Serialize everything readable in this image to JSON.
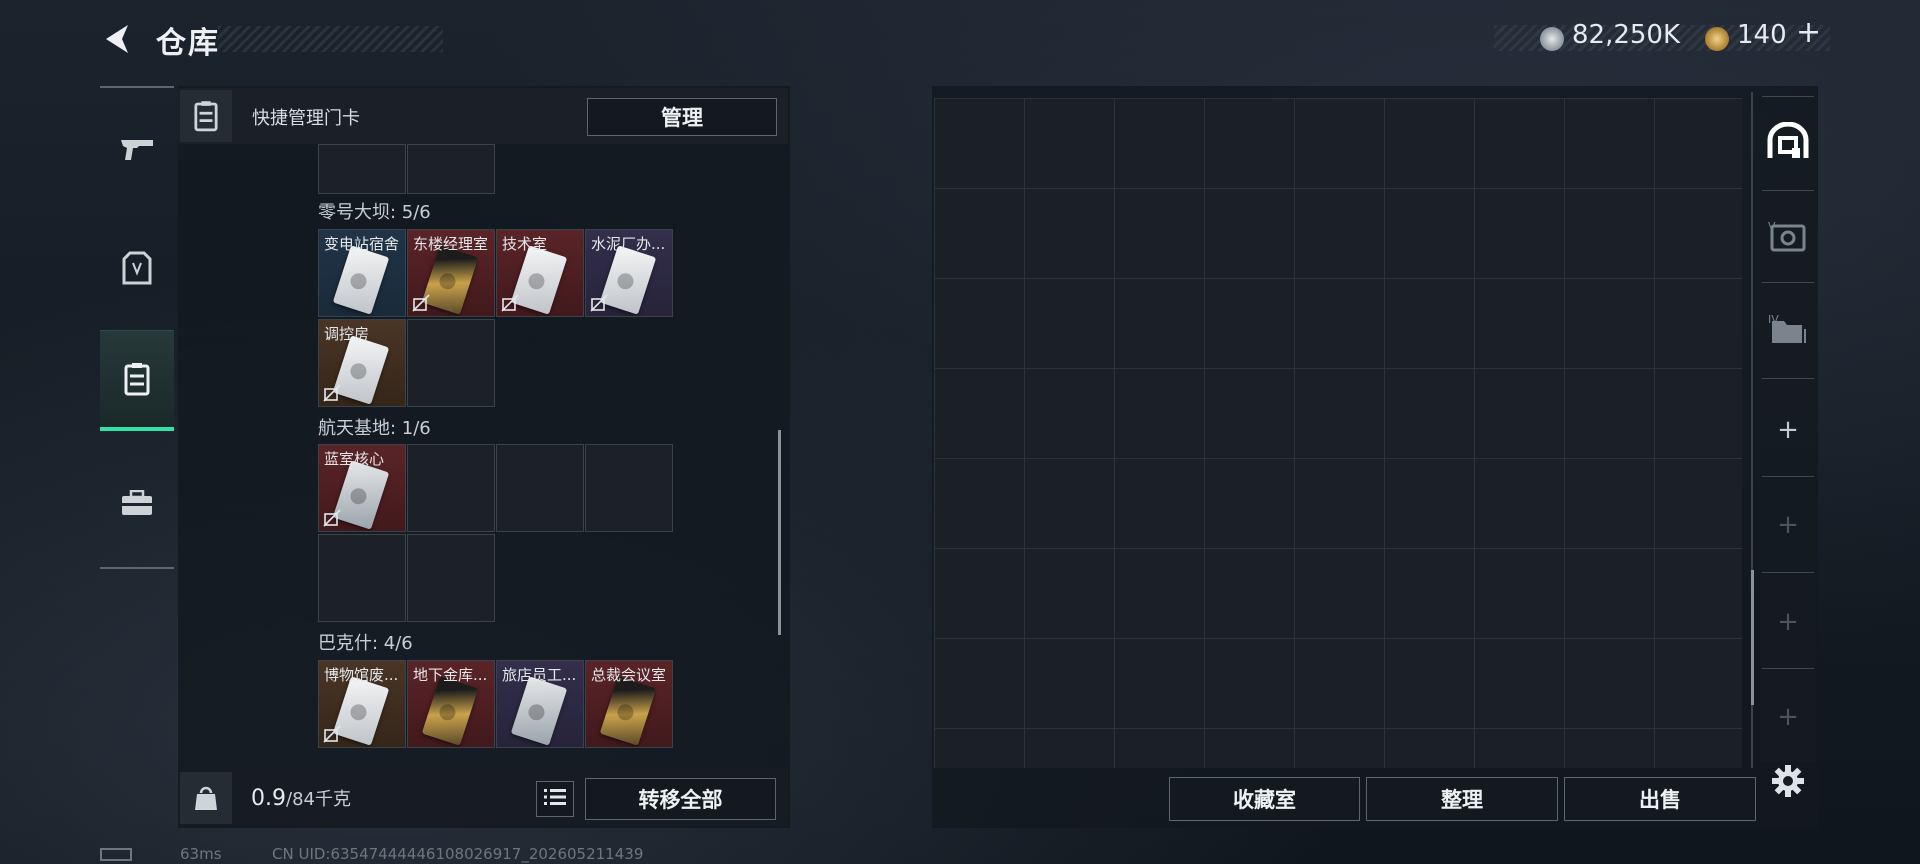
{
  "header": {
    "title": "仓库"
  },
  "currency": {
    "silver": "82,250K",
    "gold": "140",
    "plus": "+"
  },
  "quick_manage": {
    "label": "快捷管理门卡",
    "button": "管理"
  },
  "sections": [
    {
      "label": "零号大坝: 5/6",
      "cards": [
        "变电站宿舍",
        "东楼经理室",
        "技术室",
        "水泥厂办...",
        "调控房"
      ]
    },
    {
      "label": "航天基地: 1/6",
      "cards": [
        "蓝室核心"
      ]
    },
    {
      "label": "巴克什: 4/6",
      "cards": [
        "博物馆废...",
        "地下金库...",
        "旅店员工...",
        "总裁会议室"
      ]
    }
  ],
  "footer": {
    "weight_value": "0.9",
    "weight_capacity": "/84千克",
    "transfer_all": "转移全部",
    "collection": "收藏室",
    "organize": "整理",
    "sell": "出售"
  },
  "status_bar": {
    "ping": "63ms",
    "uid": "CN UID:6354744444610802691​7_202605211439"
  },
  "colors": {
    "accent": "#2fe2a8",
    "panel": "#12181f"
  }
}
